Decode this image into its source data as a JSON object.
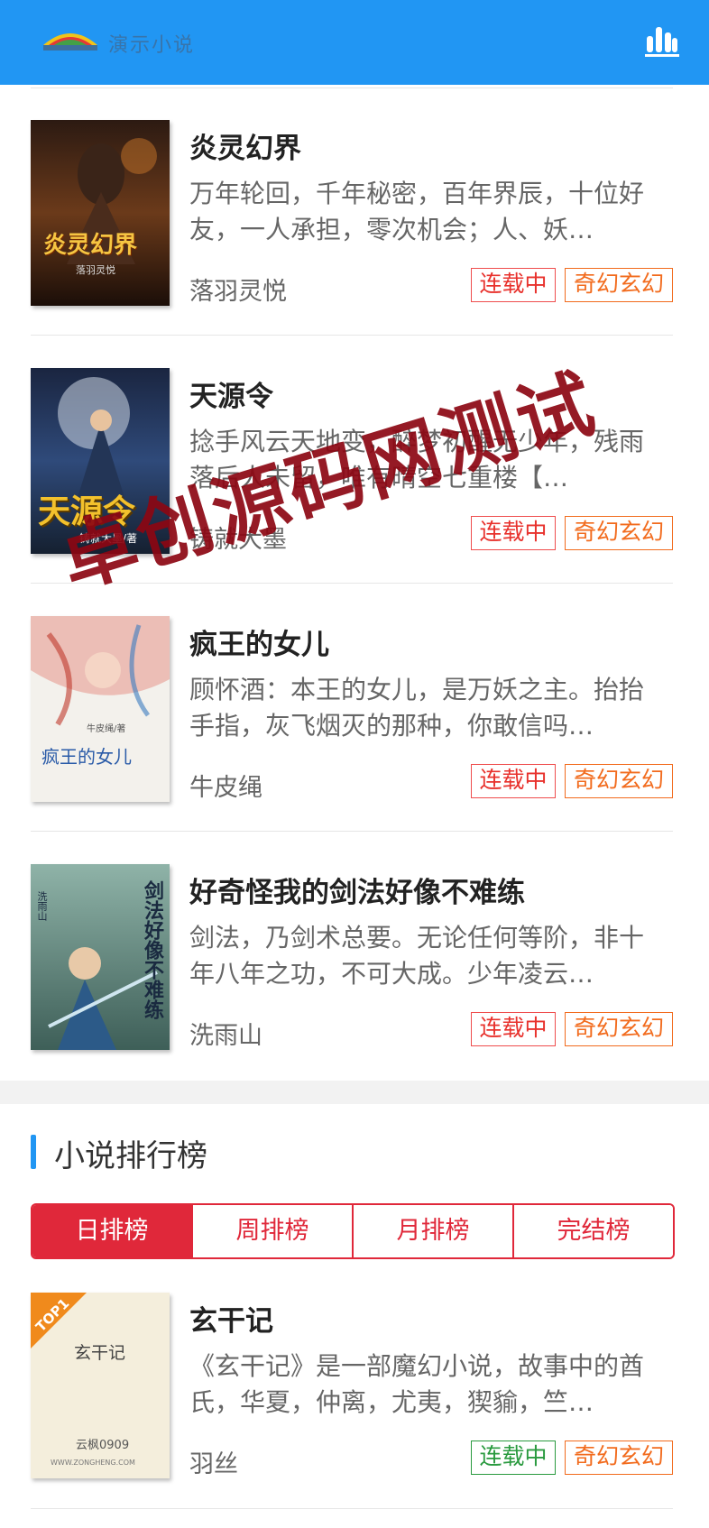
{
  "header": {
    "logo_text": "演示小说",
    "logo_icon": "rainbow-logo-icon",
    "ranking_icon": "bar-chart-icon",
    "bg_color": "#2196F3"
  },
  "books": [
    {
      "title": "炎灵幻界",
      "desc": "万年轮回，千年秘密，百年界辰，十位好友，一人承担，零次机会；人、妖…",
      "author": "落羽灵悦",
      "status": "连载中",
      "genre": "奇幻玄幻",
      "cover_text": "炎灵幻界",
      "cover_sub": "落羽灵悦"
    },
    {
      "title": "天源令",
      "desc": "捻手风云天地变，醉梦初醒无少年，残雨落后人未留，唯有晴空七重楼【…",
      "author": "铸就大墨",
      "status": "连载中",
      "genre": "奇幻玄幻",
      "cover_text": "天源令",
      "cover_sub": "铸就大墨/著"
    },
    {
      "title": "疯王的女儿",
      "desc": "顾怀酒：本王的女儿，是万妖之主。抬抬手指，灰飞烟灭的那种，你敢信吗…",
      "author": "牛皮绳",
      "status": "连载中",
      "genre": "奇幻玄幻",
      "cover_text": "疯王的女儿",
      "cover_sub": "牛皮绳/著"
    },
    {
      "title": "好奇怪我的剑法好像不难练",
      "desc": "剑法，乃剑术总要。无论任何等阶，非十年八年之功，不可大成。少年凌云…",
      "author": "洗雨山",
      "status": "连载中",
      "genre": "奇幻玄幻",
      "cover_text": "剑法好像不难练",
      "cover_sub": "洗雨山"
    }
  ],
  "ranking": {
    "section_title": "小说排行榜",
    "tabs": [
      "日排榜",
      "周排榜",
      "月排榜",
      "完结榜"
    ],
    "active_tab": "日排榜",
    "top_book": {
      "title": "玄干记",
      "desc": "《玄干记》是一部魔幻小说，故事中的酋氏，华夏，仲离，尤夷，猰貐，竺…",
      "author": "羽丝",
      "status": "连载中",
      "genre": "奇幻玄幻",
      "badge": "TOP1",
      "cover_title": "玄干记",
      "cover_author": "云枫0909",
      "cover_site": "WWW.ZONGHENG.COM"
    }
  },
  "watermark": "卓创源码网测试"
}
